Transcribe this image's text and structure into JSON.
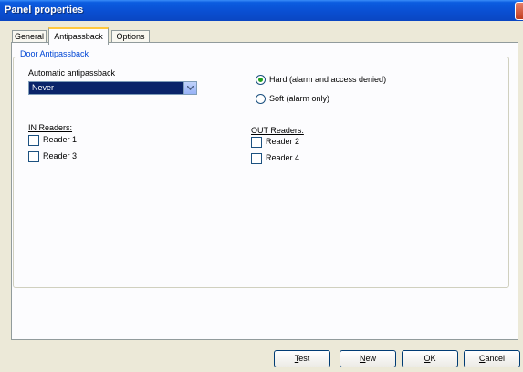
{
  "window": {
    "title": "Panel properties"
  },
  "tabs": [
    {
      "label": "General",
      "active": false
    },
    {
      "label": "Antipassback",
      "active": true
    },
    {
      "label": "Options",
      "active": false
    }
  ],
  "group": {
    "title": "Door Antipassback",
    "auto_label": "Automatic antipassback",
    "auto_selected": "Never",
    "radios": [
      {
        "label": "Hard (alarm and access denied)",
        "checked": true
      },
      {
        "label": "Soft (alarm only)",
        "checked": false
      }
    ],
    "in_readers": {
      "title": "IN Readers:",
      "items": [
        {
          "label": "Reader 1",
          "checked": false
        },
        {
          "label": "Reader 3",
          "checked": false
        }
      ]
    },
    "out_readers": {
      "title": "OUT Readers:",
      "items": [
        {
          "label": "Reader 2",
          "checked": false
        },
        {
          "label": "Reader 4",
          "checked": false
        }
      ]
    }
  },
  "buttons": [
    {
      "accel": "T",
      "rest": "est"
    },
    {
      "accel": "N",
      "rest": "ew"
    },
    {
      "accel": "O",
      "rest": "K"
    },
    {
      "accel": "C",
      "rest": "ancel"
    }
  ],
  "colors": {
    "titlebar": "#0A4FD2",
    "group_title": "#0046D5",
    "selection": "#0A246A",
    "radio_dot": "#21A121",
    "active_tab_accent": "#FFC83C"
  },
  "icons": {
    "dropdown": "chevron-down-icon",
    "close": "close-icon"
  }
}
